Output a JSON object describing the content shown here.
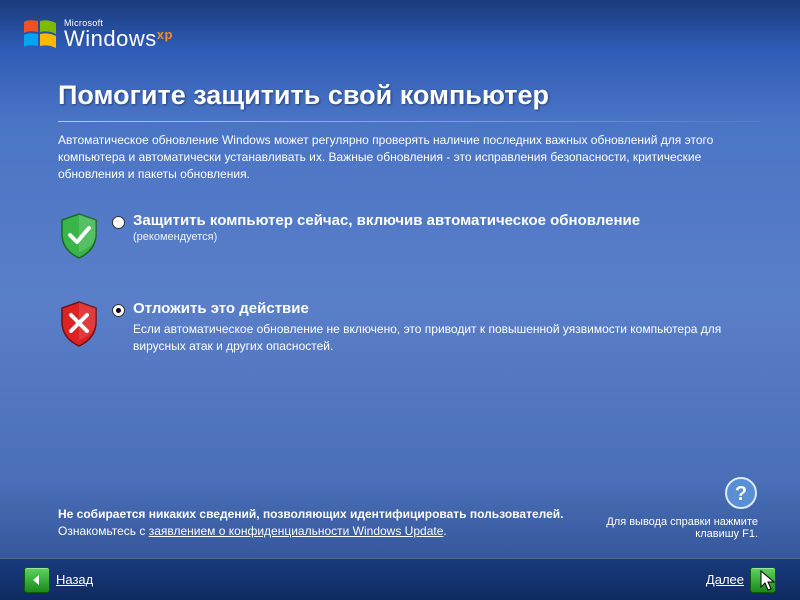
{
  "branding": {
    "company": "Microsoft",
    "product_a": "Windows",
    "product_b": "xp"
  },
  "title": "Помогите защитить свой компьютер",
  "intro": "Автоматическое обновление Windows может регулярно проверять наличие последних важных обновлений для этого компьютера и автоматически устанавливать их. Важные обновления - это исправления безопасности, критические обновления и пакеты обновления.",
  "options": [
    {
      "label": "Защитить компьютер сейчас, включив автоматическое обновление",
      "recommended": "(рекомендуется)",
      "description": "",
      "selected": false,
      "shield": "green"
    },
    {
      "label": "Отложить это действие",
      "recommended": "",
      "description": "Если автоматическое обновление не включено, это приводит к повышенной уязвимости компьютера для вирусных атак и других опасностей.",
      "selected": true,
      "shield": "red"
    }
  ],
  "privacy": {
    "bold": "Не собирается никаких сведений, позволяющих идентифицировать пользователей.",
    "lead": "Ознакомьтесь с ",
    "link": "заявлением о конфиденциальности Windows Update",
    "tail": "."
  },
  "help": "Для вывода справки нажмите клавишу F1.",
  "nav": {
    "back": "Назад",
    "next": "Далее"
  },
  "colors": {
    "shield_green": "#39b54a",
    "shield_red": "#d22",
    "arrow_green": "#2fa02f"
  }
}
